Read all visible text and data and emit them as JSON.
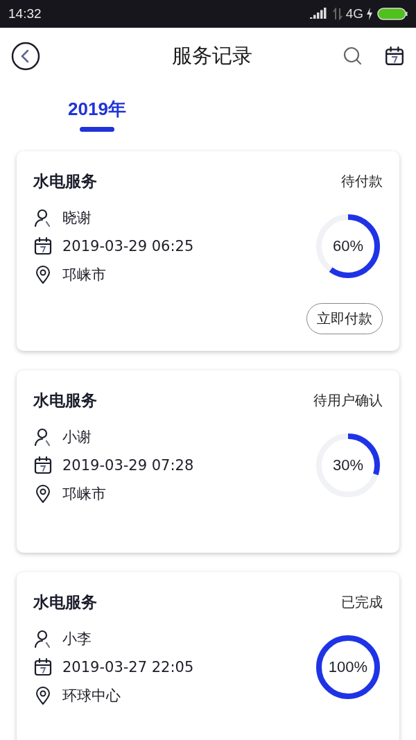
{
  "status_bar": {
    "time": "14:32",
    "network": "4G"
  },
  "header": {
    "title": "服务记录"
  },
  "tabs": [
    {
      "label": "2019年",
      "selected": true
    }
  ],
  "records": [
    {
      "service": "水电服务",
      "status": "待付款",
      "person": "晓谢",
      "datetime": "2019-03-29 06:25",
      "location": "邛崃市",
      "reading": "60%",
      "action": "立即付款"
    },
    {
      "service": "水电服务",
      "status": "待用户确认",
      "person": "小谢",
      "datetime": "2019-03-29 07:28",
      "location": "邛崃市",
      "reading": "30%"
    },
    {
      "service": "水电服务",
      "status": "已完成",
      "person": "小李",
      "datetime": "2019-03-27 22:05",
      "location": "环球中心",
      "reading": "100%"
    }
  ]
}
